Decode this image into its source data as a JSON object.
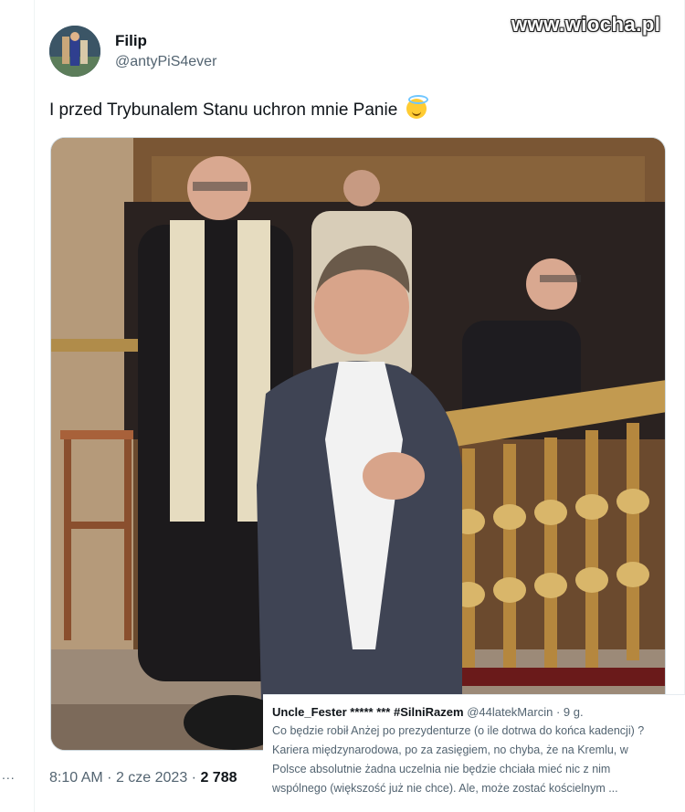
{
  "watermark": "www.wiocha.pl",
  "tweet": {
    "author_name": "Filip",
    "author_handle": "@antyPiS4ever",
    "text": "I przed Trybunalem Stanu uchron mnie Panie",
    "emoji_icon": "smiling-face-with-halo",
    "time": "8:10 AM",
    "separator": "·",
    "date": "2 cze 2023",
    "separator2": "·",
    "views_count": "2 788"
  },
  "quote": {
    "author_name": "Uncle_Fester",
    "author_tags": "***** *** #SilniRazem",
    "author_handle": "@44latekMarcin",
    "separator": "·",
    "age": "9 g.",
    "lines": [
      "Co będzie robił Anżej po prezydenturze (o ile dotrwa do końca kadencji) ?",
      "Kariera międzynarodowa, po za zasięgiem, no chyba, że na Kremlu, w",
      "Polsce absolutnie żadna uczelnia nie będzie chciała mieć nic z nim",
      "wspólnego (większość już nie chce). Ale, może zostać kościelnym ..."
    ]
  },
  "rail": {
    "more_dots": "..."
  }
}
